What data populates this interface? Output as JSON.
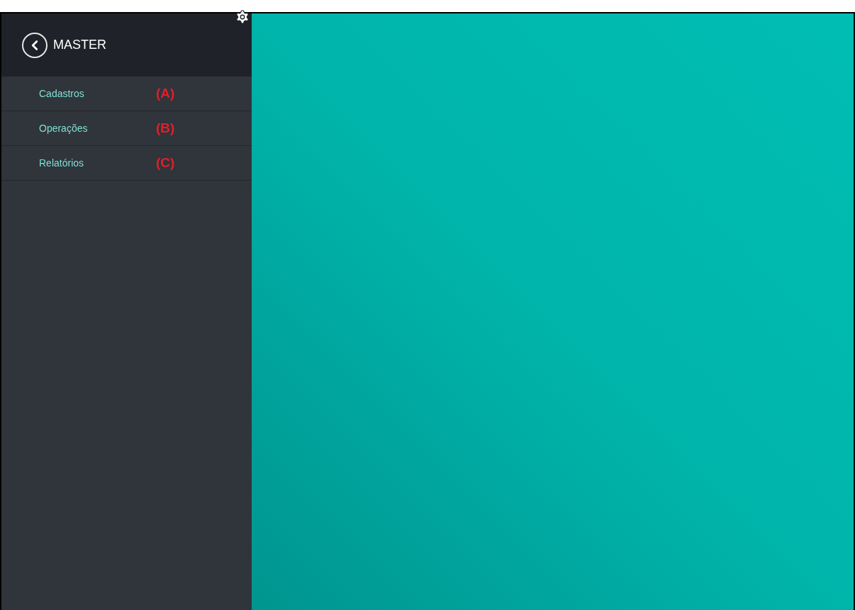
{
  "sidebar": {
    "title": "MASTER",
    "items": [
      {
        "label": "Cadastros",
        "marker": "(A)"
      },
      {
        "label": "Operações",
        "marker": "(B)"
      },
      {
        "label": "Relatórios",
        "marker": "(C)"
      }
    ]
  }
}
